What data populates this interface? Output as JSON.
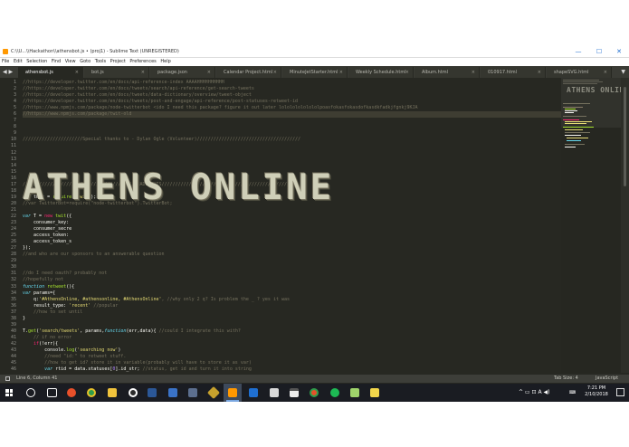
{
  "window": {
    "title": "C:\\\\U...\\\\Hackathon\\\\athensbot.js • (proj1) - Sublime Text (UNREGISTERED)",
    "controls": {
      "minimize": "—",
      "maximize": "☐",
      "close": "✕"
    }
  },
  "menu": [
    "File",
    "Edit",
    "Selection",
    "Find",
    "View",
    "Goto",
    "Tools",
    "Project",
    "Preferences",
    "Help"
  ],
  "tab_arrows": "◀ ▶",
  "tabs": [
    {
      "label": "athensbot.js",
      "active": true
    },
    {
      "label": "bot.js",
      "active": false
    },
    {
      "label": "package.json",
      "active": false
    },
    {
      "label": "Calendar Project.html",
      "active": false
    },
    {
      "label": "MinuteJetStarter.html",
      "active": false
    },
    {
      "label": "Weekly Schedule.html",
      "active": false
    },
    {
      "label": "Album.html",
      "active": false
    },
    {
      "label": "010917.html",
      "active": false
    },
    {
      "label": "shapeSVG.html",
      "active": false
    }
  ],
  "tab_close": "×",
  "tab_dropdown": "▼",
  "line_numbers": [
    "1",
    "2",
    "3",
    "4",
    "5",
    "6",
    "7",
    "8",
    "9",
    "10",
    "11",
    "12",
    "13",
    "14",
    "15",
    "16",
    "17",
    "18",
    "19",
    "20",
    "21",
    "22",
    "23",
    "24",
    "25",
    "26",
    "27",
    "28",
    "29",
    "30",
    "31",
    "32",
    "33",
    "34",
    "35",
    "36",
    "37",
    "38",
    "39",
    "40",
    "41",
    "42",
    "43",
    "44",
    "45",
    "46"
  ],
  "banner_text": "ATHENS ONLINE",
  "code": {
    "l1": "//https://developer.twitter.com/en/docs/api-reference-index AAAAHHHHHHHHHH",
    "l2": "//https://developer.twitter.com/en/docs/tweets/search/api-reference/get-search-tweets",
    "l3": "//https://developer.twitter.com/en/docs/tweets/data-dictionary/overview/tweet-object",
    "l4": "//https://developer.twitter.com/en/docs/tweets/post-and-engage/api-reference/post-statuses-retweet-id",
    "l5": "//https://www.npmjs.com/package/node-twitterbot <ido I need this package? figure it out later lolololololololpoasfokasfokasdofkasdkfadkjfgnkj9KJA",
    "l6": "//https://www.npmjs.com/package/twit-old",
    "l10": "//////////////////////Special thanks to - Dylan Ogle (Volunteer)//////////////////////////////////////",
    "l17": "///////////////////////////////////////// MADE THIS//////////////////////////////////////////////////",
    "l19_kw": "var",
    "l19_a": " twit = ",
    "l19_fn": "require",
    "l19_b": "(",
    "l19_str": "'twit'",
    "l19_c": ");",
    "l20": "//var TwitterBot=require(\"node-twitterbot\").TwitterBot;",
    "l22_kw": "var",
    "l22_a": " T = ",
    "l22_kw2": "new",
    "l22_fn": " twit",
    "l22_b": "({",
    "l23": "    consumer_key:",
    "l24": "    consumer_secre",
    "l25": "    access_token:",
    "l26": "    access_token_s",
    "l27": "});",
    "l28": "//and who are our sponsors to an answerable question",
    "l31": "//do I need oauth? probably not",
    "l32": "//hopefully not",
    "l33_kw": "function",
    "l33_fn": " retweet",
    "l33_a": "(){",
    "l34_kw": "var",
    "l34_a": " params={",
    "l35_a": "    q:",
    "l35_str": "'#AthensOnline, #athensonline, #AthensOnline'",
    "l35_com": ", //why only 2 q? Is problem the _ ? yes it was",
    "l36_a": "    result_type: ",
    "l36_str": "'recent'",
    "l36_com": " //popular",
    "l37": "    //how to set until",
    "l38": "}",
    "l40_a": "T.",
    "l40_fn": "get",
    "l40_b": "(",
    "l40_str": "'search/tweets'",
    "l40_c": ", params,",
    "l40_kw": "function",
    "l40_d": "(err,data){ ",
    "l40_com": "//could I integrate this with?",
    "l41": "    // if no error",
    "l42_kw": "    if",
    "l42_a": "(!err){",
    "l43_a": "        console.",
    "l43_fn": "log",
    "l43_b": "(",
    "l43_str": "'searching now'",
    "l43_c": ")",
    "l44": "        //need \"id:\" to retweet stuff.",
    "l45": "        //how to get id? store it in variable(probably will have to store it as var)",
    "l46_kw": "        var",
    "l46_a": " rtid = data.statuses[",
    "l46_num": "0",
    "l46_b": "].id_str; ",
    "l46_com": "//status, get id and turn it into string"
  },
  "minimap_title": "ATHENS ONLINE",
  "status": {
    "position": "Line 6, Column 41",
    "tab_size": "Tab Size: 4",
    "syntax": "JavaScript"
  },
  "taskbar": {
    "time": "7:21 PM",
    "date": "2/10/2018",
    "tray_text": "^ ▭ ⊡ A ◀)"
  },
  "colors": {
    "editor_bg": "#272822",
    "comment": "#75715e",
    "keyword": "#f92672",
    "string": "#e6db74",
    "function": "#a6e22e"
  }
}
